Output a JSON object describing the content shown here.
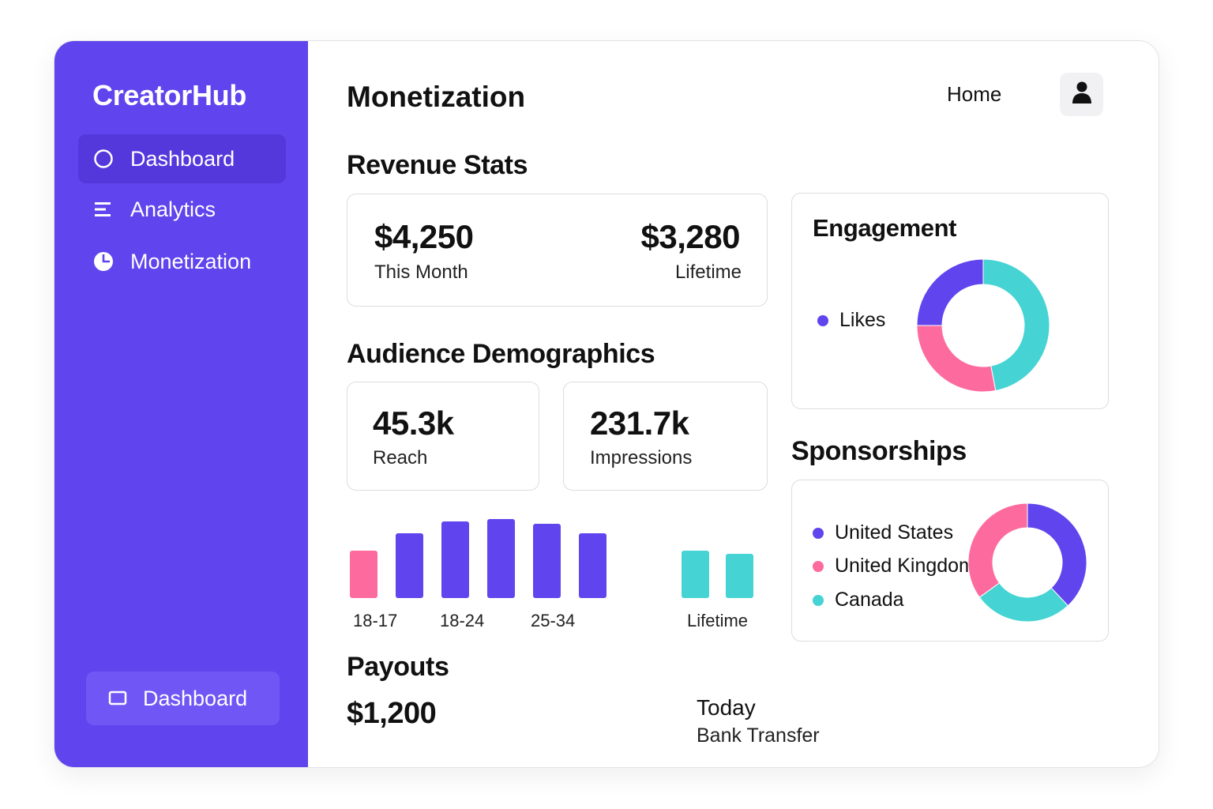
{
  "app": {
    "name": "CreatorHub"
  },
  "sidebar": {
    "items": [
      {
        "label": "Dashboard",
        "icon": "circle-icon",
        "active": true
      },
      {
        "label": "Analytics",
        "icon": "list-icon",
        "active": false
      },
      {
        "label": "Monetization",
        "icon": "pie-icon",
        "active": false
      }
    ],
    "bottom_button": {
      "label": "Dashboard",
      "icon": "square-icon"
    }
  },
  "header": {
    "title": "Monetization",
    "home_label": "Home",
    "avatar_icon": "user-icon"
  },
  "revenue": {
    "title": "Revenue Stats",
    "this_month_value": "$4,250",
    "this_month_label": "This Month",
    "lifetime_value": "$3,280",
    "lifetime_label": "Lifetime"
  },
  "audience": {
    "title": "Audience Demographics",
    "reach_value": "45.3k",
    "reach_label": "Reach",
    "impressions_value": "231.7k",
    "impressions_label": "Impressions"
  },
  "engagement": {
    "title": "Engagement",
    "legend": [
      {
        "label": "Likes",
        "color": "#6044ee"
      }
    ]
  },
  "sponsorships": {
    "title": "Sponsorships",
    "legend": [
      {
        "label": "United States",
        "color": "#6044ee"
      },
      {
        "label": "United Kingdom",
        "color": "#fd6b9e"
      },
      {
        "label": "Canada",
        "color": "#45d3d3"
      }
    ]
  },
  "payouts": {
    "title": "Payouts",
    "amount": "$1,200",
    "date": "Today",
    "method": "Bank Transfer"
  },
  "colors": {
    "accent": "#6044ee",
    "pink": "#fd6b9e",
    "teal": "#45d3d3"
  },
  "chart_data": [
    {
      "type": "bar",
      "categories": [
        "18-17",
        "",
        "18-24",
        "",
        "25-34",
        "",
        "",
        "Lifetime"
      ],
      "values": [
        0.6,
        0.82,
        0.97,
        1.0,
        0.94,
        0.82,
        0.6,
        0.56
      ],
      "colors": [
        "#fd6b9e",
        "#6044ee",
        "#6044ee",
        "#6044ee",
        "#6044ee",
        "#6044ee",
        "#45d3d3",
        "#45d3d3"
      ],
      "tick_labels": [
        "18-17",
        "18-24",
        "25-34",
        "Lifetime"
      ]
    },
    {
      "type": "pie",
      "slices": [
        {
          "value": 47,
          "color": "#45d3d3"
        },
        {
          "value": 28,
          "color": "#fd6b9e"
        },
        {
          "value": 25,
          "color": "#6044ee"
        }
      ],
      "legend": [
        "Likes"
      ]
    },
    {
      "type": "pie",
      "slices": [
        {
          "value": 38,
          "color": "#6044ee"
        },
        {
          "value": 27,
          "color": "#45d3d3"
        },
        {
          "value": 35,
          "color": "#fd6b9e"
        }
      ],
      "legend": [
        "United States",
        "United Kingdom",
        "Canada"
      ]
    }
  ]
}
